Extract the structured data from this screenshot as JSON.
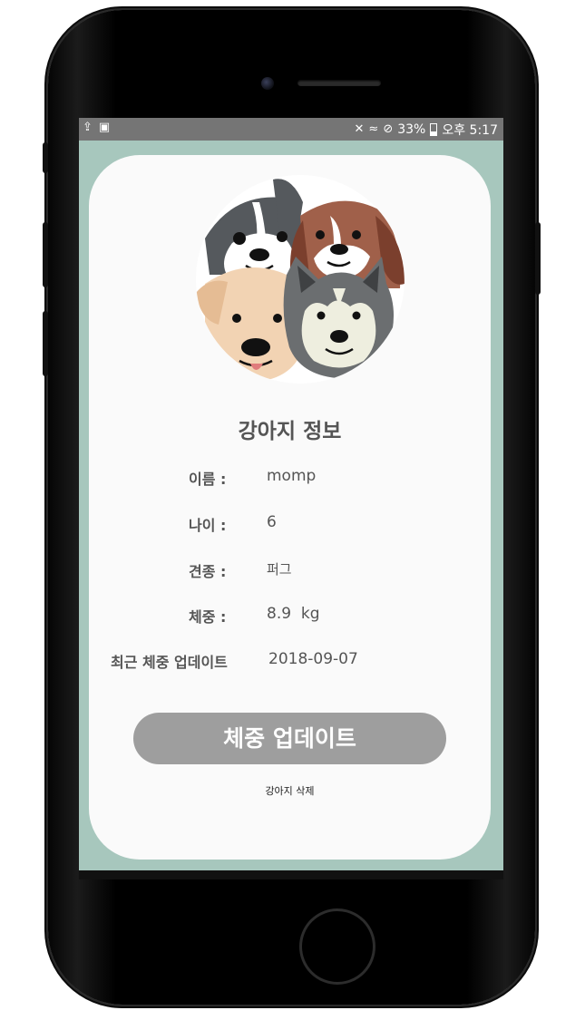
{
  "status_bar": {
    "left_icons": [
      "upload-icon",
      "image-icon"
    ],
    "right_icons": [
      "mute-icon",
      "wifi-icon",
      "blocked-icon",
      "battery-icon"
    ],
    "battery": "33%",
    "time": "오후 5:17"
  },
  "profile": {
    "title": "강아지 정보",
    "fields": [
      {
        "label": "이름 :",
        "value": "momp"
      },
      {
        "label": "나이 :",
        "value": "6"
      },
      {
        "label": "견종 :",
        "value": "퍼그"
      },
      {
        "label": "체중 :",
        "value": "8.9  kg"
      },
      {
        "label": "최근 체중 업데이트",
        "value": "2018-09-07"
      }
    ]
  },
  "actions": {
    "update_weight": "체중 업데이트",
    "delete_dog": "강아지 삭제"
  },
  "colors": {
    "screen_background": "#a7c7bd",
    "card_background": "#fafafa",
    "button_background": "#9e9e9e",
    "status_bar": "#757575",
    "text": "#555555"
  }
}
